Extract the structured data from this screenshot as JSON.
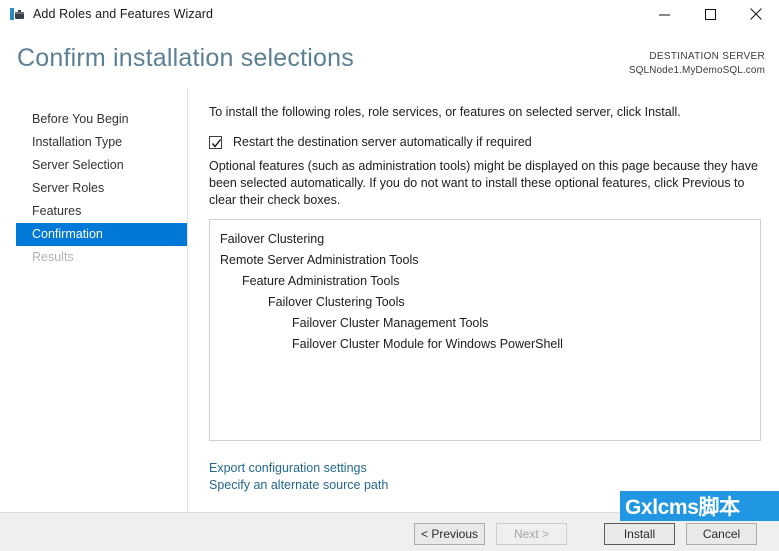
{
  "window": {
    "title": "Add Roles and Features Wizard",
    "icon": "server-manager-icon",
    "controls": {
      "minimize": "minimize-icon",
      "maximize": "maximize-icon",
      "close": "close-icon"
    }
  },
  "header": {
    "page_title": "Confirm installation selections",
    "destination_label": "DESTINATION SERVER",
    "destination_value": "SQLNode1.MyDemoSQL.com"
  },
  "nav": {
    "items": [
      {
        "label": "Before You Begin",
        "state": "normal"
      },
      {
        "label": "Installation Type",
        "state": "normal"
      },
      {
        "label": "Server Selection",
        "state": "normal"
      },
      {
        "label": "Server Roles",
        "state": "normal"
      },
      {
        "label": "Features",
        "state": "normal"
      },
      {
        "label": "Confirmation",
        "state": "selected"
      },
      {
        "label": "Results",
        "state": "disabled"
      }
    ]
  },
  "main": {
    "intro_text": "To install the following roles, role services, or features on selected server, click Install.",
    "restart_checkbox": {
      "label": "Restart the destination server automatically if required",
      "checked": true
    },
    "optional_text": "Optional features (such as administration tools) might be displayed on this page because they have been selected automatically. If you do not want to install these optional features, click Previous to clear their check boxes.",
    "features": [
      {
        "label": "Failover Clustering",
        "indent": 0
      },
      {
        "label": "Remote Server Administration Tools",
        "indent": 0
      },
      {
        "label": "Feature Administration Tools",
        "indent": 1
      },
      {
        "label": "Failover Clustering Tools",
        "indent": 2
      },
      {
        "label": "Failover Cluster Management Tools",
        "indent": 3
      },
      {
        "label": "Failover Cluster Module for Windows PowerShell",
        "indent": 3
      }
    ],
    "links": [
      "Export configuration settings",
      "Specify an alternate source path"
    ]
  },
  "footer": {
    "previous_label": "< Previous",
    "next_label": "Next >",
    "install_label": "Install",
    "cancel_label": "Cancel"
  },
  "watermark": {
    "text": "Gxlcms脚本",
    "color": "#2196e3"
  },
  "colors": {
    "accent": "#0078d7",
    "title_color": "#5b7f95",
    "link": "#24688f"
  }
}
